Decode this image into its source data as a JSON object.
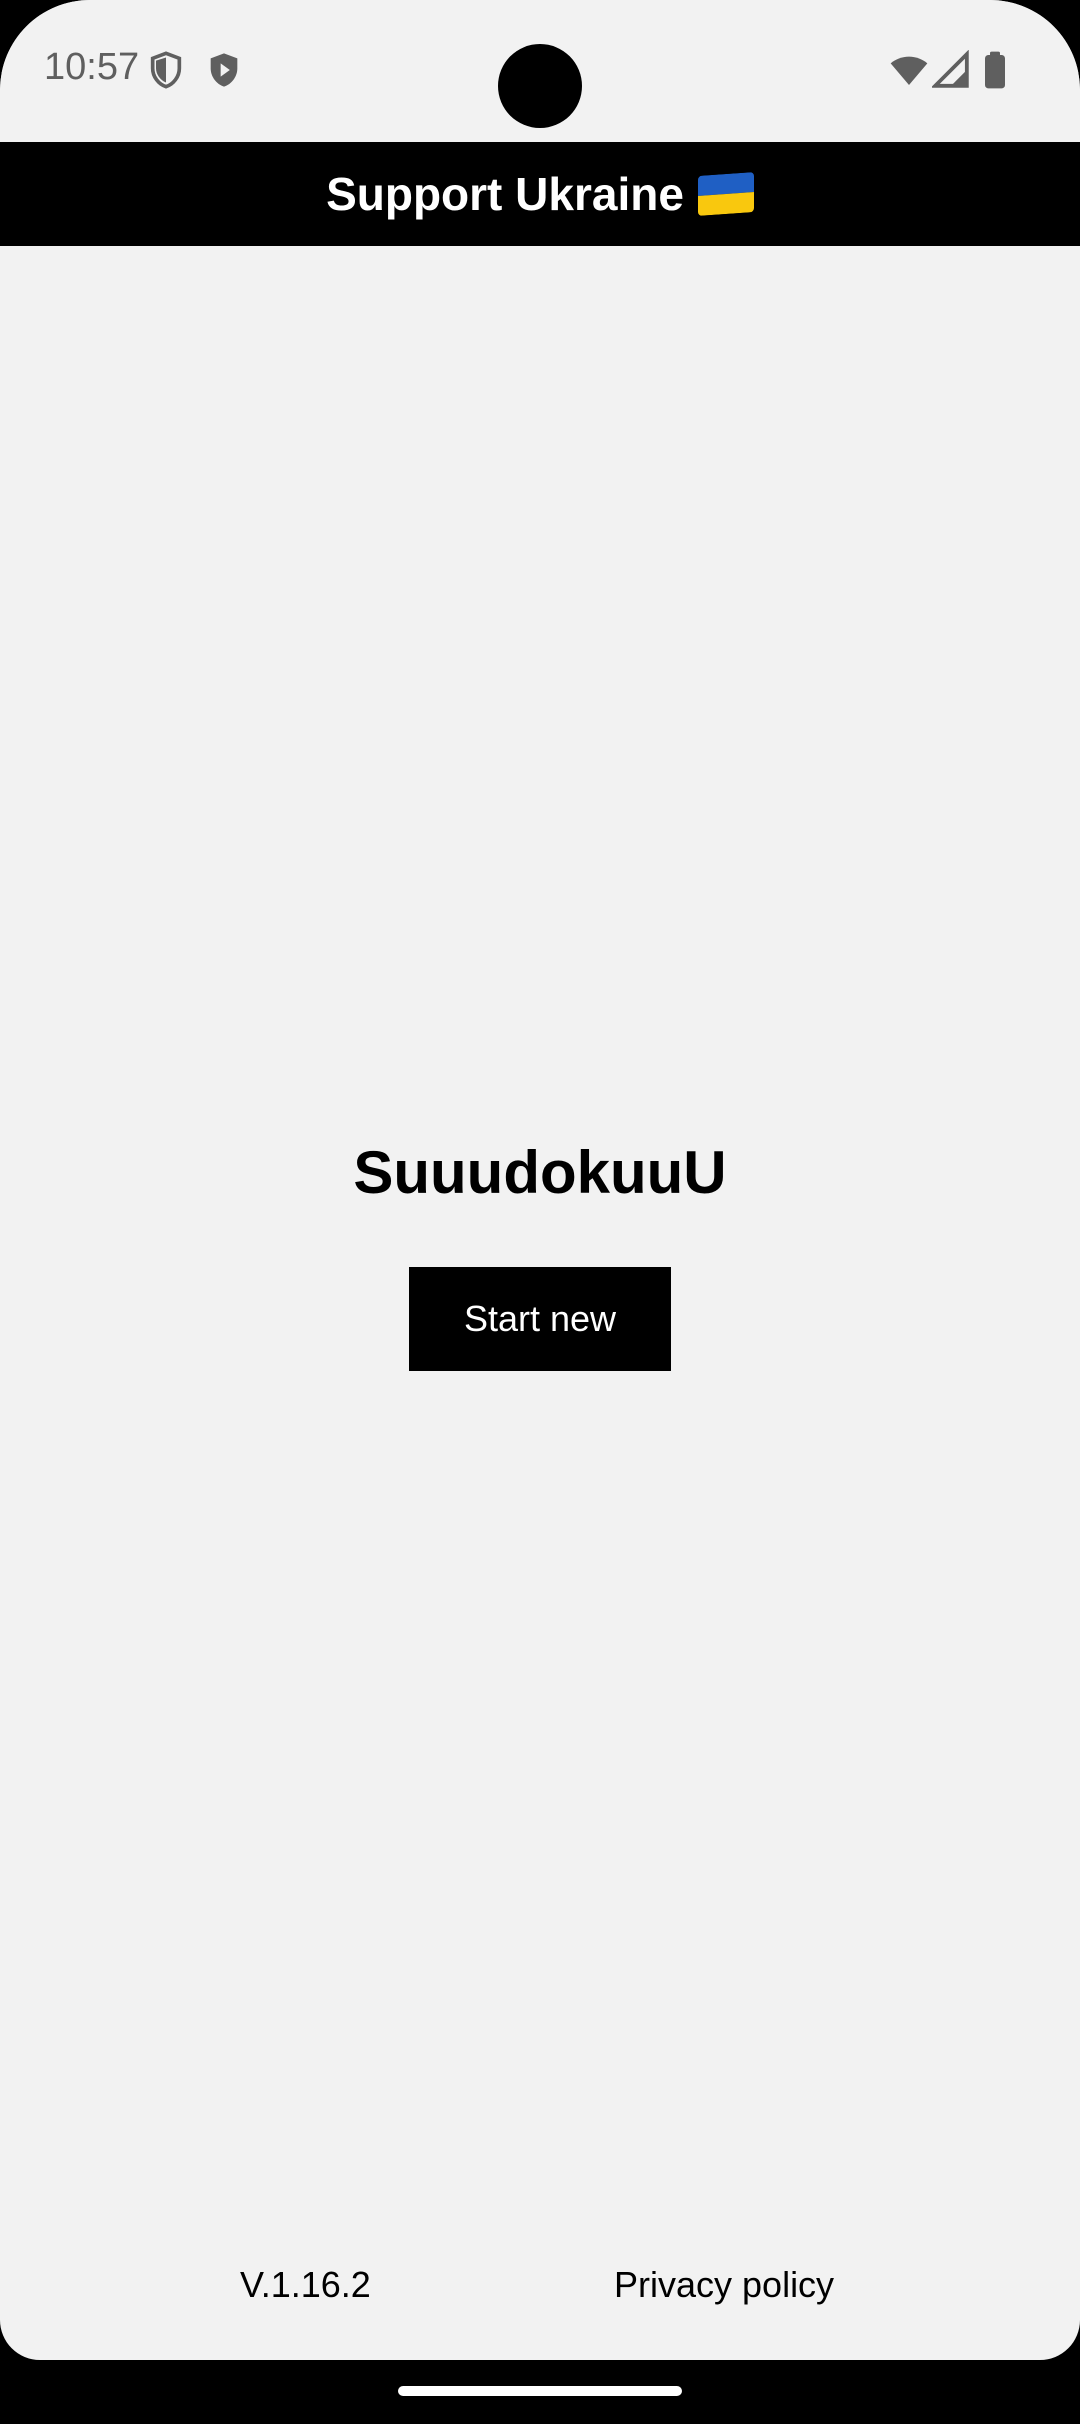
{
  "status_bar": {
    "time": "10:57",
    "left_icons": [
      "shield-outline-icon",
      "play-shield-icon"
    ],
    "right_icons": [
      "wifi-icon",
      "signal-icon",
      "battery-icon"
    ]
  },
  "app_bar": {
    "title": "Support Ukraine",
    "flag_icon": "ukraine-flag-icon",
    "colors": {
      "background": "#000000",
      "text": "#ffffff",
      "flag_blue": "#1f5fc4",
      "flag_yellow": "#f9c80e"
    }
  },
  "main": {
    "game_title": "SuuudokuuU",
    "start_button_label": "Start new"
  },
  "footer": {
    "version": "V.1.16.2",
    "privacy_link": "Privacy policy"
  },
  "colors": {
    "screen_background": "#f2f2f2",
    "button_background": "#000000",
    "button_text": "#ffffff"
  }
}
